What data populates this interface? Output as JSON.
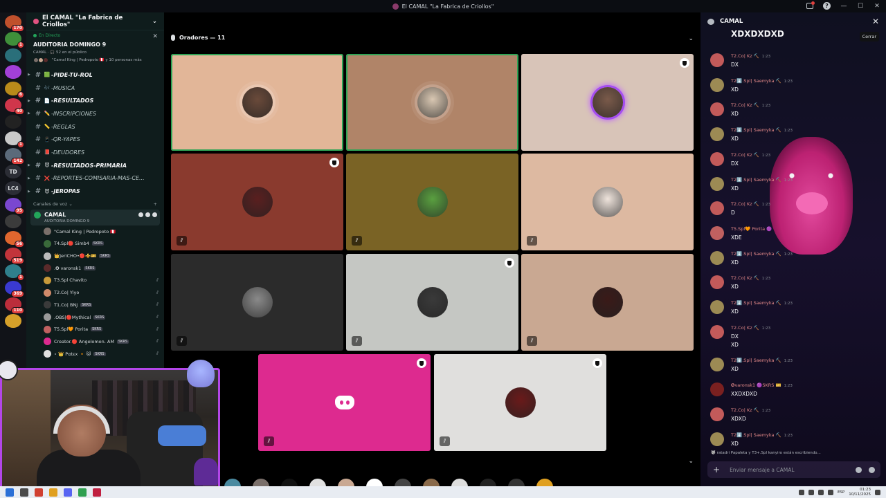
{
  "window": {
    "title": "El CAMAL \"La Fabrica de Criollos\""
  },
  "rail": {
    "servers": [
      {
        "color": "#c0502c",
        "badge": "170"
      },
      {
        "color": "#3f8f3a",
        "badge": "1"
      },
      {
        "color": "#2a6f7a",
        "badge": ""
      },
      {
        "color": "#a340d8",
        "badge": ""
      },
      {
        "color": "#b98a1a",
        "badge": "6"
      },
      {
        "color": "#d0364b",
        "badge": "40"
      },
      {
        "color": "#222222",
        "badge": ""
      },
      {
        "color": "#c9c9c9",
        "badge": "1"
      },
      {
        "color": "#5b6a7a",
        "badge": "142"
      },
      {
        "text": "TD"
      },
      {
        "text": "LC4"
      },
      {
        "color": "#7a47d0",
        "badge": "95"
      },
      {
        "color": "#3b3b3b",
        "badge": ""
      },
      {
        "color": "#e0662e",
        "badge": "56"
      },
      {
        "color": "#c2343b",
        "badge": "519"
      },
      {
        "color": "#2f7f8c",
        "badge": "1"
      },
      {
        "color": "#3a3ad0",
        "badge": "369"
      },
      {
        "color": "#bb2d3b",
        "badge": "110"
      },
      {
        "color": "#d6a12a",
        "badge": ""
      }
    ]
  },
  "sidebar": {
    "server_name": "El CAMAL \"La Fabrica de Criollos\"",
    "live": {
      "label": "En Directo",
      "title": "AUDITORIA DOMINGO 9",
      "sub": "CAMAL · 🎧 52 en el público",
      "users": "\"Camal King | Pedropoto 🇵🇪 y 10 personas más"
    },
    "channels": [
      {
        "emoji": "🟩",
        "name": "-PIDE-TU-ROL",
        "bold": true,
        "arrow": true
      },
      {
        "emoji": "🎶",
        "name": "-MUSICA",
        "bold": false,
        "arrow": false
      },
      {
        "emoji": "📄",
        "name": "-RESULTADOS",
        "bold": true,
        "arrow": true
      },
      {
        "emoji": "✏️",
        "name": "-INSCRIPCIONES",
        "bold": false,
        "arrow": true
      },
      {
        "emoji": "📏",
        "name": "-REGLAS",
        "bold": false,
        "arrow": false
      },
      {
        "emoji": "📱",
        "name": "-QR-YAPES",
        "bold": false,
        "arrow": false
      },
      {
        "emoji": "📕",
        "name": "-DEUDORES",
        "bold": false,
        "arrow": false
      },
      {
        "emoji": "😈",
        "name": "-RESULTADOS-PRIMARIA",
        "bold": true,
        "arrow": true
      },
      {
        "emoji": "❌",
        "name": "-REPORTES-COMISARIA-MAS-CE...",
        "bold": false,
        "arrow": true
      },
      {
        "emoji": "😈",
        "name": "-JEROPAS",
        "bold": true,
        "arrow": true
      }
    ],
    "voice_header": "Canales de voz",
    "voice_channel": {
      "name": "CAMAL",
      "status": "AUDITORIA DOMINGO 9"
    },
    "members": [
      {
        "name": "\"Camal King | Pedropoto 🇵🇪",
        "tag": "",
        "muted": false,
        "color": "#7a6f6a"
      },
      {
        "name": "T4.Spl🔴 Simb4",
        "tag": "SKRS",
        "muted": false,
        "color": "#3a6a3a"
      },
      {
        "name": "👑JeriCHO•🔴⚜️🎫",
        "tag": "SKRS",
        "muted": false,
        "color": "#bbbbbb"
      },
      {
        "name": ".✪ varonsk1",
        "tag": "SKRS",
        "muted": false,
        "color": "#5a2a2a"
      },
      {
        "name": "T3.Spl Chavito",
        "tag": "",
        "muted": true,
        "color": "#c89a3a"
      },
      {
        "name": "T2.Co| Yiyo",
        "tag": "",
        "muted": true,
        "color": "#d08a6a"
      },
      {
        "name": "T1.Co| BNJ",
        "tag": "SKRS",
        "muted": true,
        "color": "#3a3a3a"
      },
      {
        "name": ".OBS|🔴Mythical",
        "tag": "SKRS",
        "muted": true,
        "color": "#9a9a9a"
      },
      {
        "name": "T5.Spl🧡 Porita",
        "tag": "SKRS",
        "muted": true,
        "color": "#c06060"
      },
      {
        "name": "Creator.🔴 Angelomon. AM",
        "tag": "SKRS",
        "muted": true,
        "color": "#dd2a8f"
      },
      {
        "name": "⋆ 👑 Pαtεx 🔸 🐱",
        "tag": "SKRS",
        "muted": true,
        "color": "#e0e0e0"
      }
    ]
  },
  "main": {
    "header": "Oradores — 11",
    "tiles": [
      {
        "bg": "#e2b698",
        "av": "#6a4a3a",
        "speaking": true,
        "shield": false,
        "muted": false,
        "style": "ring"
      },
      {
        "bg": "#b08468",
        "av": "#d9c7b2",
        "speaking": true,
        "shield": false,
        "muted": false,
        "style": "ring"
      },
      {
        "bg": "#d8c4b8",
        "av": "#7a5a4a",
        "speaking": false,
        "shield": true,
        "muted": false,
        "style": "purple"
      },
      {
        "bg": "#8a3a2e",
        "av": "#5a1f1f",
        "speaking": false,
        "shield": true,
        "muted": true,
        "style": ""
      },
      {
        "bg": "#7a6325",
        "av": "#5aa040",
        "speaking": false,
        "shield": false,
        "muted": true,
        "style": ""
      },
      {
        "bg": "#ddb9a1",
        "av": "#efe4dc",
        "speaking": false,
        "shield": false,
        "muted": true,
        "style": ""
      },
      {
        "bg": "#2b2b2b",
        "av": "#8a8a8a",
        "speaking": false,
        "shield": false,
        "muted": true,
        "style": ""
      },
      {
        "bg": "#c5c7c3",
        "av": "#3a3a3a",
        "speaking": false,
        "shield": true,
        "muted": true,
        "style": ""
      },
      {
        "bg": "#c9a892",
        "av": "#3a1a18",
        "speaking": false,
        "shield": false,
        "muted": true,
        "style": ""
      },
      {
        "bg": "#dd2a8f",
        "av": "discord",
        "speaking": false,
        "shield": true,
        "muted": true,
        "style": ""
      },
      {
        "bg": "#e0dfdd",
        "av": "#6a1a1a",
        "speaking": false,
        "shield": true,
        "muted": true,
        "style": ""
      }
    ]
  },
  "chat": {
    "title": "CAMAL",
    "close_tooltip": "Cerrar",
    "pinned_top": "XDXDXDXD",
    "messages": [
      {
        "name": "T2.Co| Kz ⛏️",
        "time": "1:23",
        "text": "DX",
        "text2": "",
        "color": "#c25a5a"
      },
      {
        "name": "T2⬇️.Spl| Saemyka ⛏️",
        "time": "1:23",
        "text": "XD",
        "text2": "",
        "color": "#9c8a54"
      },
      {
        "name": "T2.Co| Kz ⛏️",
        "time": "1:23",
        "text": "XD",
        "text2": "",
        "color": "#c25a5a"
      },
      {
        "name": "T2⬇️.Spl| Saemyka ⛏️",
        "time": "1:23",
        "text": "XD",
        "text2": "",
        "color": "#9c8a54"
      },
      {
        "name": "T2.Co| Kz ⛏️",
        "time": "1:23",
        "text": "DX",
        "text2": "",
        "color": "#c25a5a"
      },
      {
        "name": "T2⬇️.Spl| Saemyka ⛏️",
        "time": "1:23",
        "text": "XD",
        "text2": "",
        "color": "#9c8a54"
      },
      {
        "name": "T2.Co| Kz ⛏️",
        "time": "1:23",
        "text": "D",
        "text2": "",
        "color": "#c25a5a"
      },
      {
        "name": "T5.Spl🧡 Porita 🟣",
        "time": "",
        "text": "XDE",
        "text2": "",
        "color": "#c06060"
      },
      {
        "name": "T2⬇️.Spl| Saemyka ⛏️",
        "time": "1:23",
        "text": "XD",
        "text2": "",
        "color": "#9c8a54"
      },
      {
        "name": "T2.Co| Kz ⛏️",
        "time": "1:23",
        "text": "XD",
        "text2": "",
        "color": "#c25a5a"
      },
      {
        "name": "T2⬇️.Spl| Saemyka ⛏️",
        "time": "1:23",
        "text": "XD",
        "text2": "",
        "color": "#9c8a54"
      },
      {
        "name": "T2.Co| Kz ⛏️",
        "time": "1:23",
        "text": "DX",
        "text2": "XD",
        "color": "#c25a5a"
      },
      {
        "name": "T2⬇️.Spl| Saemyka ⛏️",
        "time": "1:23",
        "text": "XD",
        "text2": "",
        "color": "#9c8a54"
      },
      {
        "name": "✪varonsk1 🟣SKRS 🎫",
        "time": "1:23",
        "text": "XXDXDXD",
        "text2": "",
        "color": "#7a2020"
      },
      {
        "name": "T2.Co| Kz ⛏️",
        "time": "1:23",
        "text": "XDXD",
        "text2": "",
        "color": "#c25a5a"
      },
      {
        "name": "T2⬇️.Spl| Saemyka ⛏️",
        "time": "1:23",
        "text": "XD",
        "text2": "",
        "color": "#9c8a54"
      }
    ],
    "typing": "🐺 ratadri Papaleta y T3+.Spl kanyiro están escribiendo...",
    "input_placeholder": "Enviar mensaje a CAMAL"
  },
  "taskbar": {
    "lang": "ESP",
    "time": "01:23",
    "date": "10/11/2025"
  }
}
